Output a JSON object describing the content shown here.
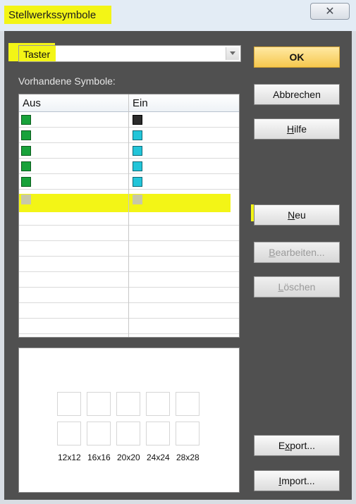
{
  "window": {
    "title": "Stellwerkssymbole",
    "close_glyph": "✕"
  },
  "combo": {
    "value": "Taster"
  },
  "list": {
    "label": "Vorhandene Symbole:",
    "col_off": "Aus",
    "col_on": "Ein"
  },
  "buttons": {
    "ok": "OK",
    "abbrechen": "Abbrechen",
    "hilfe_ul": "H",
    "hilfe_rest": "ilfe",
    "neu_ul": "N",
    "neu_rest": "eu",
    "bearbeiten_ul": "B",
    "bearbeiten_rest": "earbeiten...",
    "loeschen_ul": "L",
    "loeschen_rest": "öschen",
    "export_pre": "E",
    "export_ul": "x",
    "export_rest": "port...",
    "import_ul": "I",
    "import_rest": "mport..."
  },
  "preview": {
    "sizes": [
      "12x12",
      "16x16",
      "20x20",
      "24x24",
      "28x28"
    ]
  },
  "colors": {
    "highlight": "#f3f516",
    "dialog_bg": "#505050",
    "ok_button": "#f6c84e",
    "symbol_off": "#18a23a",
    "symbol_on": "#22c5d9"
  },
  "icons": {
    "close": "close-icon",
    "dropdown": "chevron-down-icon"
  }
}
